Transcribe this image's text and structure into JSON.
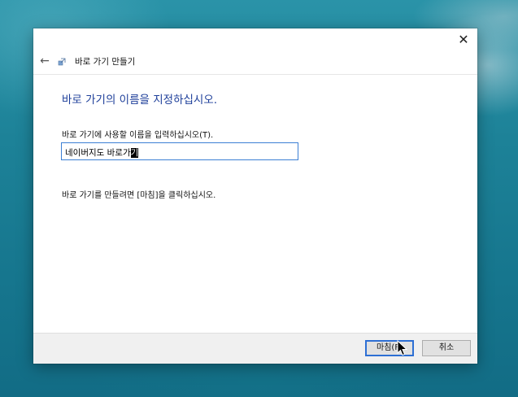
{
  "window": {
    "close_label": "✕",
    "back_label": "←",
    "title": "바로 가기 만들기",
    "icon": "shortcut-icon"
  },
  "content": {
    "heading": "바로 가기의 이름을 지정하십시오.",
    "field_label": "바로 가기에 사용할 이름을 입력하십시오(T).",
    "input_value_before": "네이버지도 바로가",
    "input_value_selected": "기",
    "hint": "바로 가기를 만들려면 [마침]을 클릭하십시오."
  },
  "footer": {
    "finish_label": "마침(F)",
    "cancel_label": "취소"
  },
  "colors": {
    "heading": "#1e3f9a",
    "input_border": "#3c7fd4",
    "default_button_border": "#2d6fd4"
  }
}
